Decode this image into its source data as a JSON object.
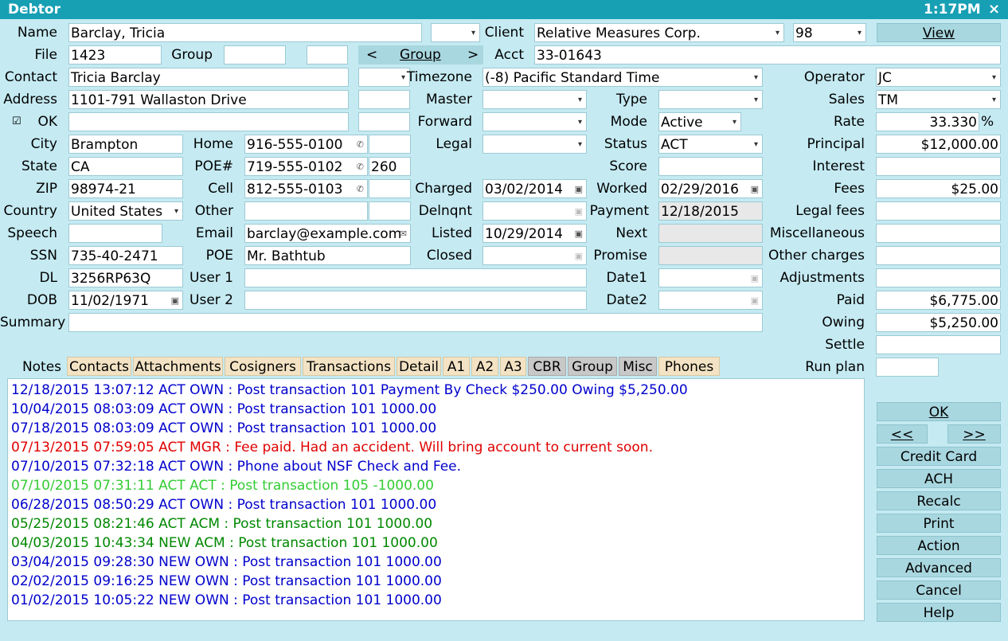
{
  "window": {
    "title": "Debtor",
    "time": "1:17PM",
    "close": "×"
  },
  "labels": {
    "name": "Name",
    "file": "File",
    "contact": "Contact",
    "address": "Address",
    "ok": "OK",
    "city": "City",
    "state": "State",
    "zip": "ZIP",
    "country": "Country",
    "speech": "Speech",
    "ssn": "SSN",
    "dl": "DL",
    "dob": "DOB",
    "summary": "Summary",
    "group": "Group",
    "home": "Home",
    "poe_num": "POE#",
    "cell": "Cell",
    "other": "Other",
    "email": "Email",
    "poe": "POE",
    "user1": "User 1",
    "user2": "User 2",
    "client": "Client",
    "acct": "Acct",
    "timezone": "Timezone",
    "master": "Master",
    "forward": "Forward",
    "legal": "Legal",
    "charged": "Charged",
    "delnqnt": "Delnqnt",
    "listed": "Listed",
    "closed": "Closed",
    "type": "Type",
    "mode": "Mode",
    "status": "Status",
    "score": "Score",
    "worked": "Worked",
    "payment": "Payment",
    "next": "Next",
    "promise": "Promise",
    "date1": "Date1",
    "date2": "Date2",
    "operator": "Operator",
    "sales": "Sales",
    "rate": "Rate",
    "principal": "Principal",
    "interest": "Interest",
    "fees": "Fees",
    "legal_fees": "Legal fees",
    "miscellaneous": "Miscellaneous",
    "other_charges": "Other charges",
    "adjustments": "Adjustments",
    "paid": "Paid",
    "owing": "Owing",
    "settle": "Settle",
    "run_plan": "Run plan",
    "percent": "%"
  },
  "values": {
    "name": "Barclay, Tricia",
    "file": "1423",
    "contact": "Tricia Barclay",
    "address": "1101-791 Wallaston Drive",
    "city": "Brampton",
    "state": "CA",
    "zip": "98974-21",
    "country": "United States",
    "ssn": "735-40-2471",
    "dl": "3256RP63Q",
    "dob": "11/02/1971",
    "home": "916-555-0100",
    "poe_phone": "719-555-0102",
    "poe_ext": "260",
    "cell": "812-555-0103",
    "email": "barclay@example.com",
    "poe": "Mr. Bathtub",
    "client": "Relative Measures Corp.",
    "client_num": "98",
    "acct": "33-01643",
    "timezone": "(-8) Pacific Standard Time",
    "charged": "03/02/2014",
    "listed": "10/29/2014",
    "mode": "Active",
    "status": "ACT",
    "worked": "02/29/2016",
    "payment": "12/18/2015",
    "operator": "JC",
    "sales": "TM",
    "rate": "33.330",
    "principal": "$12,000.00",
    "fees": "$25.00",
    "paid": "$6,775.00",
    "owing": "$5,250.00"
  },
  "group_nav": {
    "prev": "<",
    "label": "Group",
    "next": ">"
  },
  "buttons": {
    "view": "View",
    "ok": "OK",
    "prev": "<<",
    "next": ">>",
    "credit_card": "Credit Card",
    "ach": "ACH",
    "recalc": "Recalc",
    "print": "Print",
    "action": "Action",
    "advanced": "Advanced",
    "cancel": "Cancel",
    "help": "Help"
  },
  "tabs": [
    "Notes",
    "Contacts",
    "Attachments",
    "Cosigners",
    "Transactions",
    "Detail",
    "A1",
    "A2",
    "A3",
    "CBR",
    "Group",
    "Misc",
    "Phones"
  ],
  "notes": [
    {
      "text": "12/18/2015 13:07:12 ACT OWN : Post transaction 101 Payment By Check $250.00 Owing $5,250.00",
      "color": "#0000cc"
    },
    {
      "text": "10/04/2015 08:03:09 ACT OWN : Post transaction 101 1000.00",
      "color": "#0000cc"
    },
    {
      "text": "07/18/2015 08:03:09 ACT OWN : Post transaction 101 1000.00",
      "color": "#0000cc"
    },
    {
      "text": "07/13/2015 07:59:05 ACT MGR : Fee paid. Had an accident. Will bring account to current soon.",
      "color": "#e00000"
    },
    {
      "text": "07/10/2015 07:32:18 ACT OWN : Phone about NSF Check and Fee.",
      "color": "#0000cc"
    },
    {
      "text": "07/10/2015 07:31:11 ACT ACT : Post transaction 105 -1000.00",
      "color": "#33cc33"
    },
    {
      "text": "06/28/2015 08:50:29 ACT OWN : Post transaction 101 1000.00",
      "color": "#0000cc"
    },
    {
      "text": "05/25/2015 08:21:46 ACT ACM : Post transaction 101 1000.00",
      "color": "#008800"
    },
    {
      "text": "04/03/2015 10:43:34 NEW ACM : Post transaction 101 1000.00",
      "color": "#008800"
    },
    {
      "text": "03/04/2015 09:28:30 NEW OWN : Post transaction 101 1000.00",
      "color": "#0000cc"
    },
    {
      "text": "02/02/2015 09:16:25 NEW OWN : Post transaction 101 1000.00",
      "color": "#0000cc"
    },
    {
      "text": "01/02/2015 10:05:22 NEW OWN : Post transaction 101 1000.00",
      "color": "#0000cc"
    }
  ]
}
